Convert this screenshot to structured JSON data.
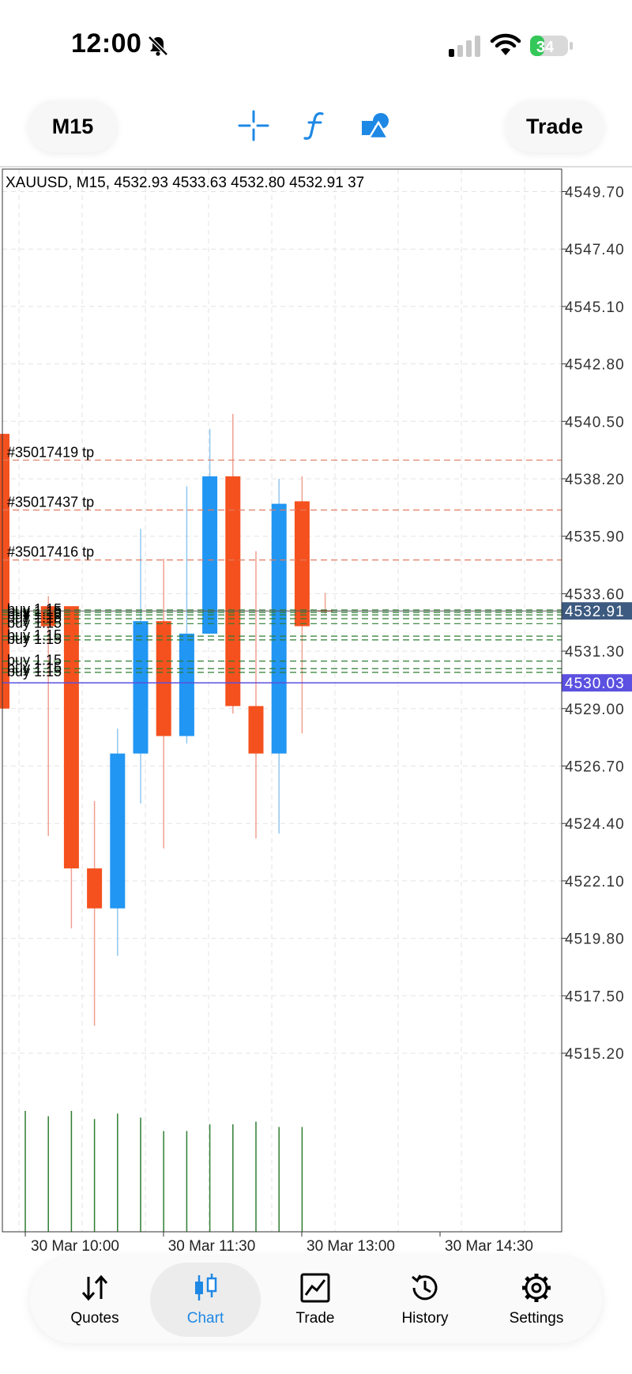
{
  "status_bar": {
    "time": "12:00",
    "battery": "34"
  },
  "toolbar": {
    "timeframe_button": "M15",
    "trade_button": "Trade",
    "tools": [
      "crosshair-icon",
      "function-icon",
      "objects-icon"
    ]
  },
  "chart": {
    "header": "XAUUSD, M15, 4532.93 4533.63 4532.80 4532.91 37",
    "price_axis": [
      "4549.70",
      "4547.40",
      "4545.10",
      "4542.80",
      "4540.50",
      "4538.20",
      "4535.90",
      "4533.60",
      "4531.30",
      "4529.00",
      "4526.70",
      "4524.40",
      "4522.10",
      "4519.80",
      "4517.50",
      "4515.20"
    ],
    "price_range": [
      4512.9,
      4551.15
    ],
    "current_price_label": "4532.91",
    "current_price": 4532.91,
    "marked_price_label": "4530.03",
    "marked_price": 4530.03,
    "time_axis": [
      "30 Mar 10:00",
      "30 Mar 11:30",
      "30 Mar 13:00",
      "30 Mar 14:30"
    ],
    "order_labels": [
      "#35017419 tp",
      "#35017437 tp",
      "#35017416 tp"
    ],
    "order_tp_prices": [
      4538.95,
      4536.95,
      4534.95
    ],
    "buy_labels": [
      "buy 1.15",
      "buy 1.15",
      "buy 1.15",
      "buy 1.15",
      "buy 1.15",
      "buy 1.15",
      "buy 1.15",
      "buy 1.15",
      "buy 1.15",
      "buy 1.15"
    ],
    "buy_prices": [
      4532.95,
      4532.85,
      4532.75,
      4532.6,
      4532.4,
      4531.9,
      4531.75,
      4530.9,
      4530.6,
      4530.45
    ],
    "colors": {
      "bull": "#2196f3",
      "bear": "#f4511e",
      "volume": "#2e7d32",
      "tp_line": "#e07a5f",
      "buy_line": "#2e7d32",
      "current_bg": "#3d5a80",
      "marked_bg": "#5b50e0"
    }
  },
  "chart_data": {
    "type": "candlestick",
    "title": "XAUUSD, M15",
    "candles": [
      {
        "open": 4540.0,
        "high": 4540.0,
        "low": 4529.0,
        "close": 4529.0
      },
      {
        "open": 4533.1,
        "high": 4533.5,
        "low": 4523.9,
        "close": 4532.3
      },
      {
        "open": 4533.1,
        "high": 4533.1,
        "low": 4520.2,
        "close": 4522.6
      },
      {
        "open": 4522.6,
        "high": 4525.3,
        "low": 4516.3,
        "close": 4521.0
      },
      {
        "open": 4521.0,
        "high": 4528.2,
        "low": 4519.1,
        "close": 4527.2
      },
      {
        "open": 4527.2,
        "high": 4536.2,
        "low": 4525.2,
        "close": 4532.5
      },
      {
        "open": 4532.5,
        "high": 4535.0,
        "low": 4523.4,
        "close": 4527.9
      },
      {
        "open": 4527.9,
        "high": 4537.9,
        "low": 4527.6,
        "close": 4532.0
      },
      {
        "open": 4532.0,
        "high": 4540.2,
        "low": 4532.0,
        "close": 4538.3
      },
      {
        "open": 4538.3,
        "high": 4540.8,
        "low": 4528.8,
        "close": 4529.1
      },
      {
        "open": 4529.1,
        "high": 4535.3,
        "low": 4523.8,
        "close": 4527.2
      },
      {
        "open": 4527.2,
        "high": 4538.2,
        "low": 4524.0,
        "close": 4537.2
      },
      {
        "open": 4537.3,
        "high": 4538.3,
        "low": 4528.0,
        "close": 4532.3
      },
      {
        "open": 4532.93,
        "high": 4533.63,
        "low": 4532.8,
        "close": 4532.91
      }
    ],
    "volume_relative": [
      0.9,
      0.86,
      0.9,
      0.84,
      0.88,
      0.85,
      0.75,
      0.75,
      0.8,
      0.8,
      0.82,
      0.78,
      0.78,
      0.0
    ]
  },
  "bottom_nav": {
    "items": [
      {
        "label": "Quotes",
        "icon": "quotes-icon"
      },
      {
        "label": "Chart",
        "icon": "chart-icon"
      },
      {
        "label": "Trade",
        "icon": "trade-icon"
      },
      {
        "label": "History",
        "icon": "history-icon"
      },
      {
        "label": "Settings",
        "icon": "settings-icon"
      }
    ],
    "active": "Chart"
  }
}
